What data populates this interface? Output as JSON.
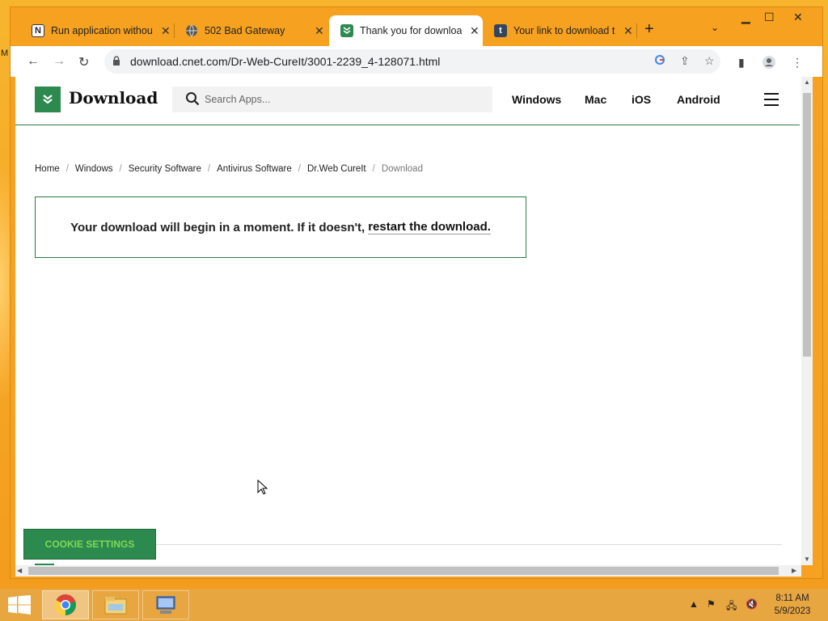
{
  "desktop": {
    "edge_letter": "M"
  },
  "tabs": [
    {
      "title": "Run application without",
      "icon": "notion-icon",
      "active": false
    },
    {
      "title": "502 Bad Gateway",
      "icon": "globe-icon",
      "active": false
    },
    {
      "title": "Thank you for downloa",
      "icon": "download-icon",
      "active": true
    },
    {
      "title": "Your link to download t",
      "icon": "tumblr-icon",
      "active": false
    }
  ],
  "toolbar": {
    "url": "download.cnet.com/Dr-Web-CureIt/3001-2239_4-128071.html"
  },
  "site": {
    "logo_text": "Download",
    "search_placeholder": "Search Apps...",
    "nav": [
      "Windows",
      "Mac",
      "iOS",
      "Android"
    ]
  },
  "breadcrumb": {
    "items": [
      "Home",
      "Windows",
      "Security Software",
      "Antivirus Software",
      "Dr.Web CureIt"
    ],
    "current": "Download",
    "separator": "/"
  },
  "notice": {
    "text": "Your download will begin in a moment. If it doesn't,",
    "link": "restart the download."
  },
  "cookie": {
    "label": "COOKIE SETTINGS"
  },
  "taskbar": {
    "time": "8:11 AM",
    "date": "5/9/2023"
  },
  "colors": {
    "brand_green": "#2d8a4e",
    "window_accent": "#f6a11f",
    "cookie_text": "#7ed957"
  }
}
